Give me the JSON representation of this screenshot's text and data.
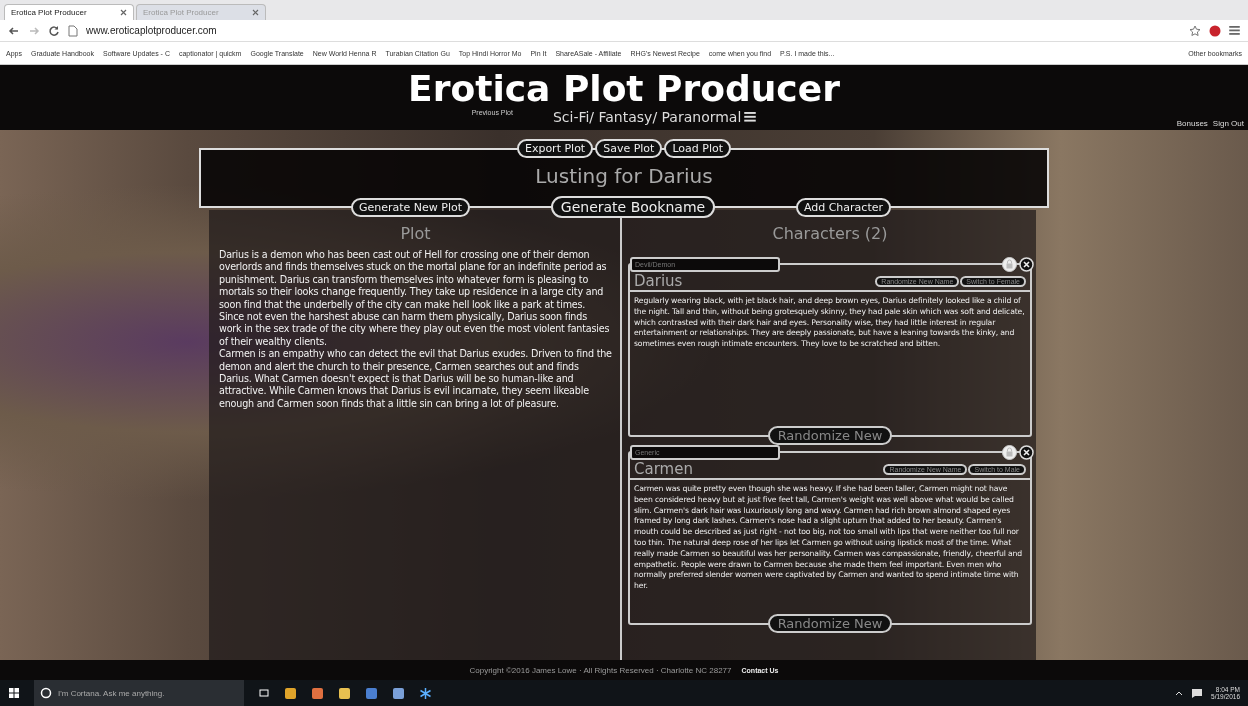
{
  "browser": {
    "tabs": [
      {
        "title": "Erotica Plot Producer",
        "selected": true
      },
      {
        "title": "Erotica Plot Producer",
        "selected": false
      }
    ],
    "url": "www.eroticaplotproducer.com",
    "bookmarks": [
      "Apps",
      "Graduate Handbook",
      "Software Updates - C",
      "captionator | quickm",
      "Google Translate",
      "New World Henna R",
      "Turabian Citation Gu",
      "Top Hindi Horror Mo",
      "Pin It",
      "ShareASale - Affiliate",
      "RHG's Newest Recipe",
      "come when you find",
      "P.S. I made this..."
    ],
    "other_bookmarks": "Other bookmarks"
  },
  "header": {
    "title": "Erotica Plot Producer",
    "previous_plot": "Previous Plot",
    "genre": "Sci-Fi/ Fantasy/ Paranormal",
    "links": [
      "Bonuses",
      "Sign Out"
    ]
  },
  "plot_actions": [
    "Export Plot",
    "Save Plot",
    "Load Plot"
  ],
  "book_title": "Lusting for Darius",
  "main_actions": [
    "Generate New Plot",
    "Generate Bookname",
    "Add Character"
  ],
  "plot": {
    "heading": "Plot",
    "paragraphs": [
      "Darius is a demon who has been cast out of Hell for crossing one of their demon overlords and finds themselves stuck on the mortal plane for an indefinite period as punishment. Darius can transform themselves into whatever form is pleasing to mortals so their looks change frequently. They take up residence in a large city and soon find that the underbelly of the city can make hell look like a park at times. Since not even the harshest abuse can harm them physically, Darius soon finds work in the sex trade of the city where they play out even the most violent fantasies of their wealthy clients.",
      "Carmen is an empathy who can detect the evil that Darius exudes. Driven to find the demon and alert the church to their presence, Carmen searches out and finds Darius. What Carmen doesn't expect is that Darius will be so human-like and attractive. While Carmen knows that Darius is evil incarnate, they seem likeable enough and Carmen soon finds that a little sin can bring a lot of pleasure."
    ]
  },
  "characters": {
    "heading": "Characters (2)",
    "items": [
      {
        "type": "Devil/Demon",
        "name": "Darius",
        "randomize_name": "Randomize New Name",
        "switch_gender": "Switch to Female",
        "description": "Regularly wearing black, with jet black hair, and deep brown eyes, Darius definitely looked like a child of the night. Tall and thin, without being grotesquely skinny, they had pale skin which was soft and delicate, which contrasted with their dark hair and eyes. Personality wise, they had little interest in regular entertainment or relationships. They are deeply passionate, but have a leaning towards the kinky, and sometimes even rough intimate encounters. They love to be scratched and bitten.",
        "randomize": "Randomize New"
      },
      {
        "type": "Generic",
        "name": "Carmen",
        "randomize_name": "Randomize New Name",
        "switch_gender": "Switch to Male",
        "description": "Carmen was quite pretty even though she was heavy. If she had been taller, Carmen might not have been considered heavy but at just five feet tall, Carmen's weight was well above what would be called slim. Carmen's dark hair was luxuriously long and wavy. Carmen had rich brown almond shaped eyes framed by long dark lashes. Carmen's nose had a slight upturn that added to her beauty. Carmen's mouth could be described as just right - not too big, not too small with lips that were neither too full nor too thin. The natural deep rose of her lips let Carmen go without using lipstick most of the time. What really made Carmen so beautiful was her personality. Carmen was compassionate, friendly, cheerful and empathetic. People were drawn to Carmen because she made them feel important. Even men who normally preferred slender women were captivated by Carmen and wanted to spend intimate time with her.",
        "randomize": "Randomize New"
      }
    ]
  },
  "footer": {
    "copyright": "Copyright ©2016 James Lowe · All Rights Reserved · Charlotte NC 28277",
    "contact": "Contact Us"
  },
  "taskbar": {
    "search_placeholder": "I'm Cortana. Ask me anything.",
    "time": "8:04 PM",
    "date": "5/19/2016"
  }
}
